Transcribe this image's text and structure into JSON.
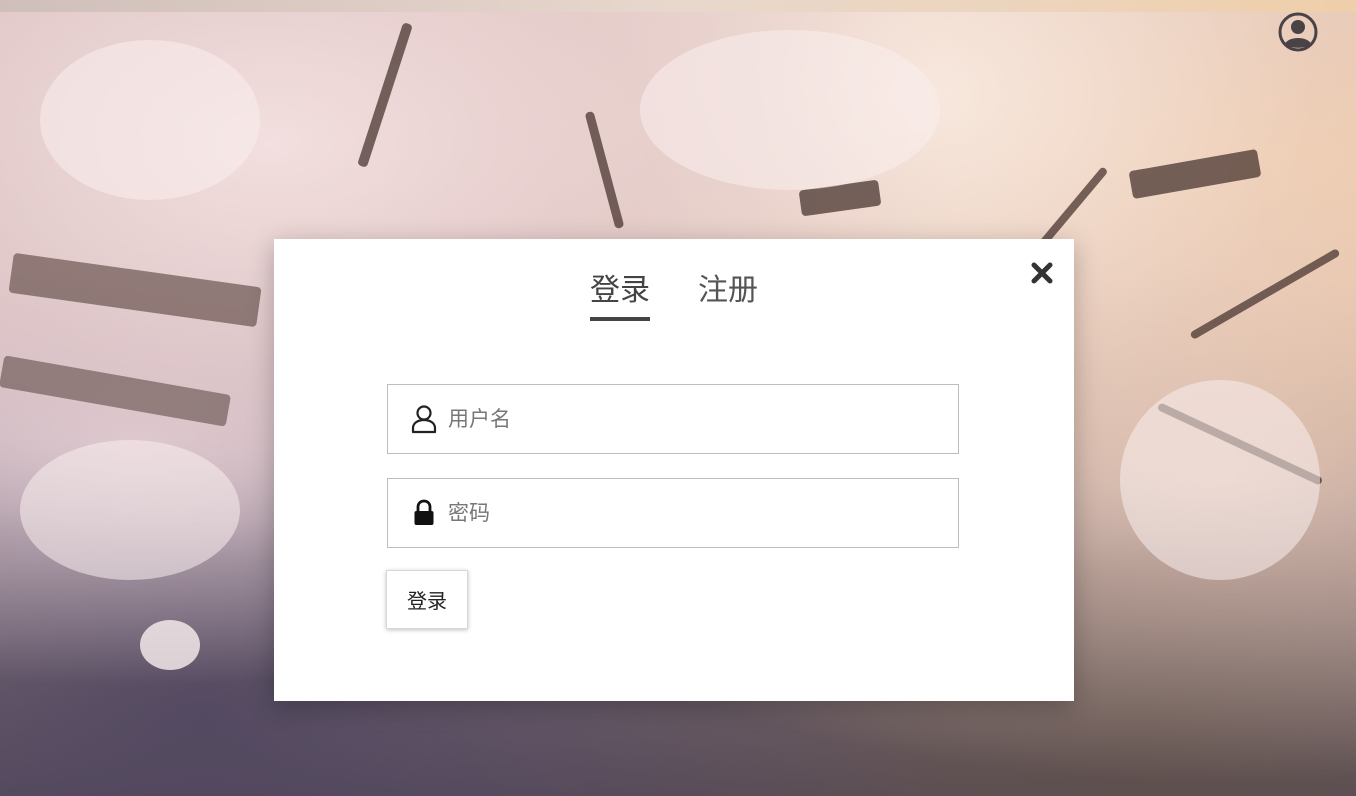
{
  "header": {
    "user_icon": "user-circle-icon"
  },
  "login_modal": {
    "close_icon": "close-icon",
    "tabs": [
      {
        "label": "登录",
        "active": true
      },
      {
        "label": "注册",
        "active": false
      }
    ],
    "username": {
      "icon": "user-outline-icon",
      "placeholder": "用户名",
      "value": ""
    },
    "password": {
      "icon": "lock-icon",
      "placeholder": "密码",
      "value": ""
    },
    "submit_label": "登录"
  },
  "colors": {
    "modal_bg": "#ffffff",
    "tab_active": "#444444",
    "field_border": "#bdbdbd"
  }
}
